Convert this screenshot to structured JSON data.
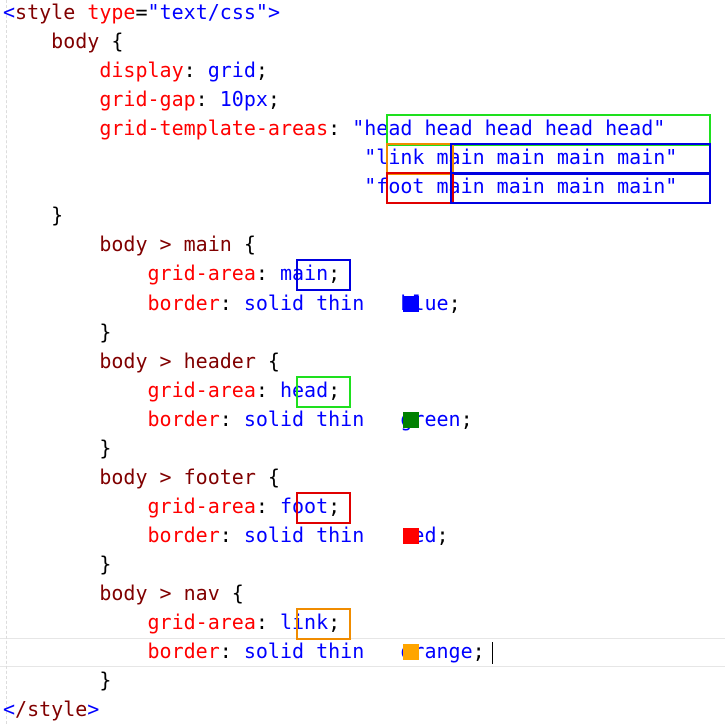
{
  "lines": [
    [
      {
        "t": "<",
        "c": "punct"
      },
      {
        "t": "style",
        "c": "tag"
      },
      {
        "t": " ",
        "c": "plain"
      },
      {
        "t": "type",
        "c": "attr"
      },
      {
        "t": "=",
        "c": "plain"
      },
      {
        "t": "\"text/css\"",
        "c": "str"
      },
      {
        "t": ">",
        "c": "punct"
      }
    ],
    [
      {
        "t": "    body ",
        "c": "sel"
      },
      {
        "t": "{",
        "c": "plain"
      }
    ],
    [
      {
        "t": "        ",
        "c": "plain"
      },
      {
        "t": "display",
        "c": "prop"
      },
      {
        "t": ": ",
        "c": "plain"
      },
      {
        "t": "grid",
        "c": "val"
      },
      {
        "t": ";",
        "c": "plain"
      }
    ],
    [
      {
        "t": "        ",
        "c": "plain"
      },
      {
        "t": "grid-gap",
        "c": "prop"
      },
      {
        "t": ": ",
        "c": "plain"
      },
      {
        "t": "10px",
        "c": "val"
      },
      {
        "t": ";",
        "c": "plain"
      }
    ],
    [
      {
        "t": "        ",
        "c": "plain"
      },
      {
        "t": "grid-template-areas",
        "c": "prop"
      },
      {
        "t": ": ",
        "c": "plain"
      },
      {
        "t": "\"head head head head head\"",
        "c": "val"
      }
    ],
    [
      {
        "t": "                              ",
        "c": "plain"
      },
      {
        "t": "\"link main main main main\"",
        "c": "val"
      }
    ],
    [
      {
        "t": "                              ",
        "c": "plain"
      },
      {
        "t": "\"foot main main main main\"",
        "c": "val"
      }
    ],
    [
      {
        "t": "    }",
        "c": "plain"
      }
    ],
    [
      {
        "t": "        body > main ",
        "c": "sel"
      },
      {
        "t": "{",
        "c": "plain"
      }
    ],
    [
      {
        "t": "            ",
        "c": "plain"
      },
      {
        "t": "grid-area",
        "c": "prop"
      },
      {
        "t": ": ",
        "c": "plain"
      },
      {
        "t": "main",
        "c": "val"
      },
      {
        "t": ";",
        "c": "plain"
      }
    ],
    [
      {
        "t": "            ",
        "c": "plain"
      },
      {
        "t": "border",
        "c": "prop"
      },
      {
        "t": ": ",
        "c": "plain"
      },
      {
        "t": "solid thin ",
        "c": "val"
      },
      {
        "t": "  ",
        "c": "plain"
      },
      {
        "t": "blue",
        "c": "val"
      },
      {
        "t": ";",
        "c": "plain"
      }
    ],
    [
      {
        "t": "        }",
        "c": "plain"
      }
    ],
    [
      {
        "t": "        body > header ",
        "c": "sel"
      },
      {
        "t": "{",
        "c": "plain"
      }
    ],
    [
      {
        "t": "            ",
        "c": "plain"
      },
      {
        "t": "grid-area",
        "c": "prop"
      },
      {
        "t": ": ",
        "c": "plain"
      },
      {
        "t": "head",
        "c": "val"
      },
      {
        "t": ";",
        "c": "plain"
      }
    ],
    [
      {
        "t": "            ",
        "c": "plain"
      },
      {
        "t": "border",
        "c": "prop"
      },
      {
        "t": ": ",
        "c": "plain"
      },
      {
        "t": "solid thin ",
        "c": "val"
      },
      {
        "t": "  ",
        "c": "plain"
      },
      {
        "t": "green",
        "c": "val"
      },
      {
        "t": ";",
        "c": "plain"
      }
    ],
    [
      {
        "t": "        }",
        "c": "plain"
      }
    ],
    [
      {
        "t": "        body > footer ",
        "c": "sel"
      },
      {
        "t": "{",
        "c": "plain"
      }
    ],
    [
      {
        "t": "            ",
        "c": "plain"
      },
      {
        "t": "grid-area",
        "c": "prop"
      },
      {
        "t": ": ",
        "c": "plain"
      },
      {
        "t": "foot",
        "c": "val"
      },
      {
        "t": ";",
        "c": "plain"
      }
    ],
    [
      {
        "t": "            ",
        "c": "plain"
      },
      {
        "t": "border",
        "c": "prop"
      },
      {
        "t": ": ",
        "c": "plain"
      },
      {
        "t": "solid thin ",
        "c": "val"
      },
      {
        "t": "  ",
        "c": "plain"
      },
      {
        "t": "red",
        "c": "val"
      },
      {
        "t": ";",
        "c": "plain"
      }
    ],
    [
      {
        "t": "        }",
        "c": "plain"
      }
    ],
    [
      {
        "t": "        body > nav ",
        "c": "sel"
      },
      {
        "t": "{",
        "c": "plain"
      }
    ],
    [
      {
        "t": "            ",
        "c": "plain"
      },
      {
        "t": "grid-area",
        "c": "prop"
      },
      {
        "t": ": ",
        "c": "plain"
      },
      {
        "t": "link",
        "c": "val"
      },
      {
        "t": ";",
        "c": "plain"
      }
    ],
    [
      {
        "t": "            ",
        "c": "plain"
      },
      {
        "t": "border",
        "c": "prop"
      },
      {
        "t": ": ",
        "c": "plain"
      },
      {
        "t": "solid thin ",
        "c": "val"
      },
      {
        "t": "  ",
        "c": "plain"
      },
      {
        "t": "orange",
        "c": "val"
      },
      {
        "t": ";",
        "c": "plain"
      }
    ],
    [
      {
        "t": "        }",
        "c": "plain"
      }
    ],
    [
      {
        "t": "<",
        "c": "punct"
      },
      {
        "t": "/style",
        "c": "tag"
      },
      {
        "t": ">",
        "c": "punct"
      }
    ]
  ],
  "swatches": [
    {
      "line": 10,
      "color": "#0000ff",
      "name": "blue"
    },
    {
      "line": 14,
      "color": "#008000",
      "name": "green"
    },
    {
      "line": 18,
      "color": "#ff0000",
      "name": "red"
    },
    {
      "line": 22,
      "color": "#ffa500",
      "name": "orange"
    }
  ],
  "highlights": [
    {
      "name": "head-row-highlight",
      "color": "green",
      "line": 4,
      "col": 30,
      "len": 25
    },
    {
      "name": "link-cell-highlight",
      "color": "orange",
      "line": 5,
      "col": 30,
      "len": 5
    },
    {
      "name": "main-row2-highlight",
      "color": "blue",
      "line": 5,
      "col": 35,
      "len": 20
    },
    {
      "name": "foot-cell-highlight",
      "color": "red",
      "line": 6,
      "col": 30,
      "len": 5
    },
    {
      "name": "main-row3-highlight",
      "color": "blue",
      "line": 6,
      "col": 35,
      "len": 20
    },
    {
      "name": "main-value-highlight",
      "color": "blue",
      "line": 9,
      "col": 23,
      "len": 4
    },
    {
      "name": "head-value-highlight",
      "color": "green",
      "line": 13,
      "col": 23,
      "len": 4
    },
    {
      "name": "foot-value-highlight",
      "color": "red",
      "line": 17,
      "col": 23,
      "len": 4
    },
    {
      "name": "link-value-highlight",
      "color": "orange",
      "line": 21,
      "col": 23,
      "len": 4
    }
  ]
}
